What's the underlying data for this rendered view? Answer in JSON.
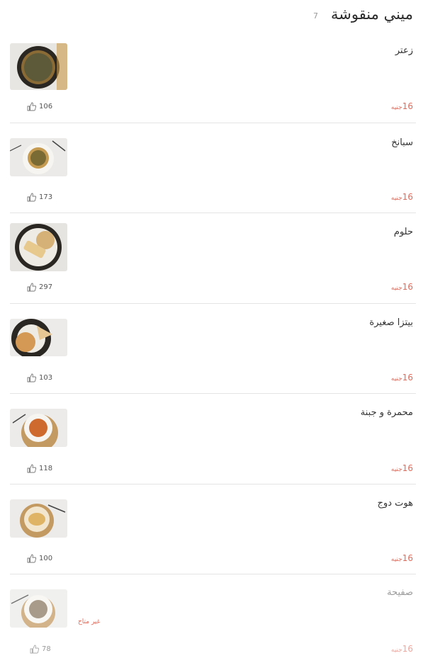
{
  "header": {
    "title": "ميني منقوشة",
    "count": "7"
  },
  "currency": "جنيه",
  "items": [
    {
      "name": "زعتر",
      "price": "16",
      "likes": "106",
      "available": true,
      "img": "zaatar"
    },
    {
      "name": "سبانخ",
      "price": "16",
      "likes": "173",
      "available": true,
      "img": "spinach"
    },
    {
      "name": "حلوم",
      "price": "16",
      "likes": "297",
      "available": true,
      "img": "halloumi"
    },
    {
      "name": "بيتزا صغيرة",
      "price": "16",
      "likes": "103",
      "available": true,
      "img": "pizza"
    },
    {
      "name": "محمرة و جبنة",
      "price": "16",
      "likes": "118",
      "available": true,
      "img": "muhammara"
    },
    {
      "name": "هوت دوج",
      "price": "16",
      "likes": "100",
      "available": true,
      "img": "hotdog"
    },
    {
      "name": "صفيحة",
      "price": "16",
      "likes": "78",
      "available": false,
      "img": "sfiha"
    }
  ],
  "unavailable_label": "غير متاح",
  "colors": {
    "price": "#e06a5a",
    "divider": "#e4e4e4",
    "title": "#2b2b2b"
  }
}
